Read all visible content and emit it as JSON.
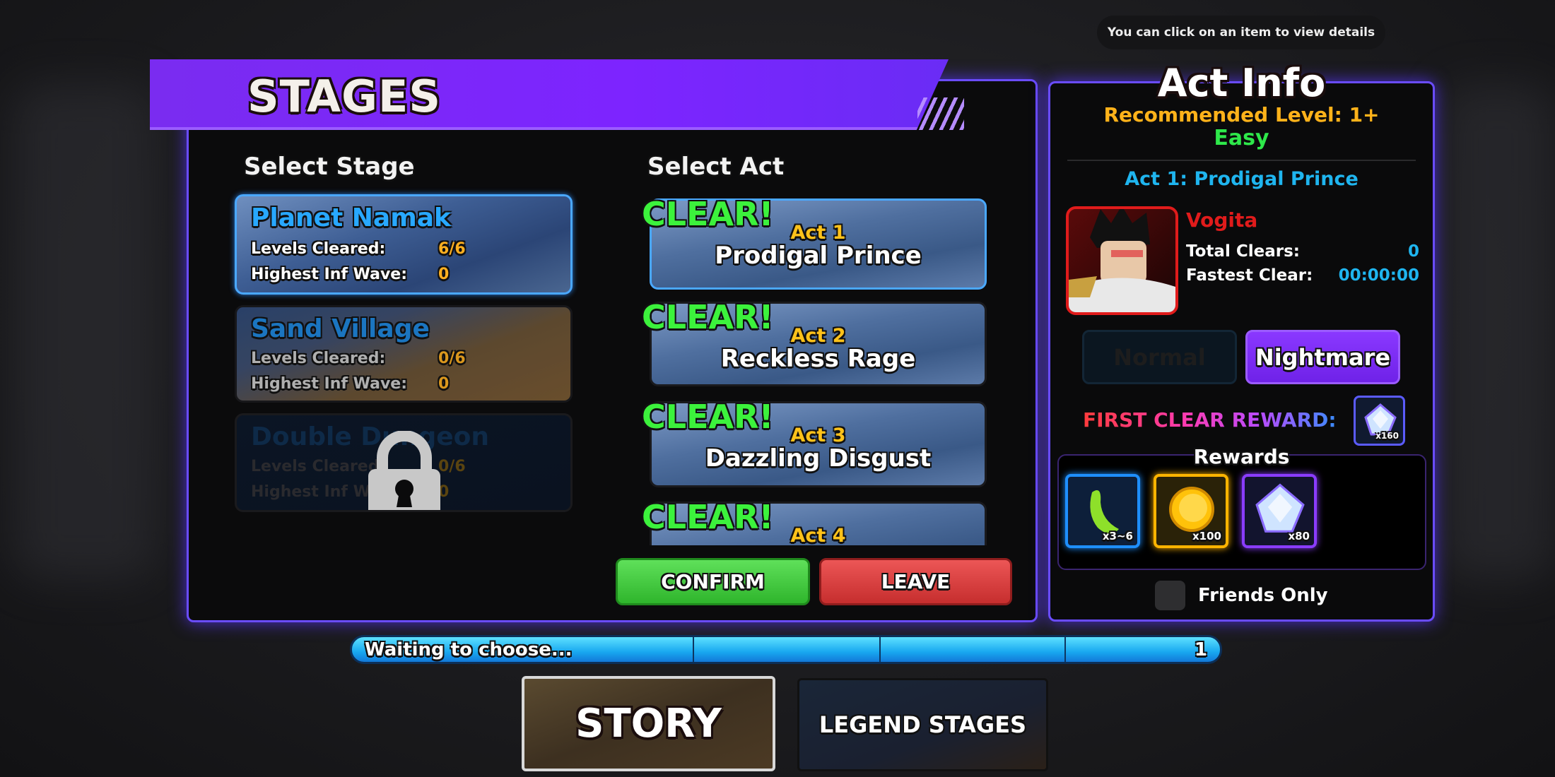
{
  "tooltip": "You can click on an item to view details",
  "stages_panel": {
    "title": "STAGES",
    "select_stage_label": "Select Stage",
    "select_act_label": "Select Act",
    "stages": [
      {
        "name": "Planet Namak",
        "levels_cleared_label": "Levels Cleared:",
        "levels_cleared": "6/6",
        "highest_wave_label": "Highest Inf Wave:",
        "highest_wave": "0",
        "selected": true,
        "locked": false
      },
      {
        "name": "Sand Village",
        "levels_cleared_label": "Levels Cleared:",
        "levels_cleared": "0/6",
        "highest_wave_label": "Highest Inf Wave:",
        "highest_wave": "0",
        "selected": false,
        "locked": false
      },
      {
        "name": "Double Dungeon",
        "levels_cleared_label": "Levels Cleared:",
        "levels_cleared": "0/6",
        "highest_wave_label": "Highest Inf Wave:",
        "highest_wave": "0",
        "selected": false,
        "locked": true
      }
    ],
    "acts": [
      {
        "badge": "CLEAR!",
        "number": "Act 1",
        "name": "Prodigal Prince",
        "selected": true
      },
      {
        "badge": "CLEAR!",
        "number": "Act 2",
        "name": "Reckless Rage",
        "selected": false
      },
      {
        "badge": "CLEAR!",
        "number": "Act 3",
        "name": "Dazzling Disgust",
        "selected": false
      },
      {
        "badge": "CLEAR!",
        "number": "Act 4",
        "name": "",
        "selected": false
      }
    ],
    "confirm_label": "CONFIRM",
    "leave_label": "LEAVE"
  },
  "act_info": {
    "title": "Act Info",
    "recommended": "Recommended Level: 1+",
    "difficulty": "Easy",
    "act_title": "Act 1: Prodigal Prince",
    "boss_name": "Vogita",
    "total_clears_label": "Total Clears:",
    "total_clears": "0",
    "fastest_clear_label": "Fastest Clear:",
    "fastest_clear": "00:00:00",
    "modes": [
      {
        "label": "Normal",
        "active": false
      },
      {
        "label": "Nightmare",
        "active": true
      }
    ],
    "first_clear_label": "FIRST CLEAR REWARD:",
    "first_clear_reward": {
      "icon": "gem-icon",
      "qty": "x160"
    },
    "rewards_label": "Rewards",
    "rewards": [
      {
        "icon": "bean-icon",
        "qty": "x3~6",
        "color": "#1e8fff"
      },
      {
        "icon": "coin-icon",
        "qty": "x100",
        "color": "#ffb400"
      },
      {
        "icon": "gem-icon",
        "qty": "x80",
        "color": "#8a3cff"
      }
    ],
    "friends_only_label": "Friends Only",
    "friends_only": false
  },
  "status_bar": {
    "text": "Waiting to choose...",
    "count": "1"
  },
  "tabs": [
    {
      "label": "STORY",
      "active": true
    },
    {
      "label": "LEGEND STAGES",
      "active": false
    }
  ],
  "colors": {
    "accent": "#7d24ff",
    "clear": "#3cf23c",
    "confirm": "#3cc83a",
    "leave": "#d83a3a"
  }
}
